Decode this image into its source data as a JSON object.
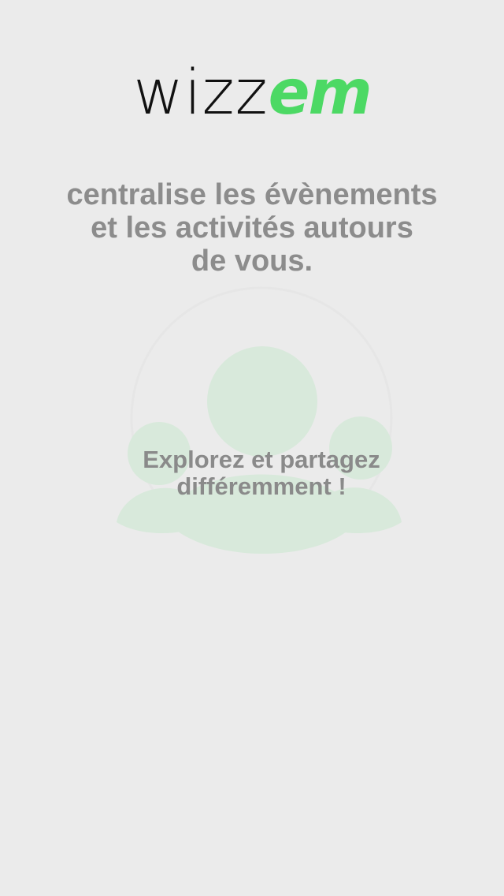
{
  "brand": {
    "logo_part1": "wizz",
    "logo_part2": "em",
    "accent_color": "#4cd964"
  },
  "tagline": {
    "line1": "centralise les évènements",
    "line2": "et les activités autours",
    "line3": "de vous."
  },
  "illustration": {
    "icon": "users-group-icon",
    "color": "#d8e9db"
  },
  "explore": {
    "line1": "Explorez et partagez",
    "line2": "différemment !"
  }
}
